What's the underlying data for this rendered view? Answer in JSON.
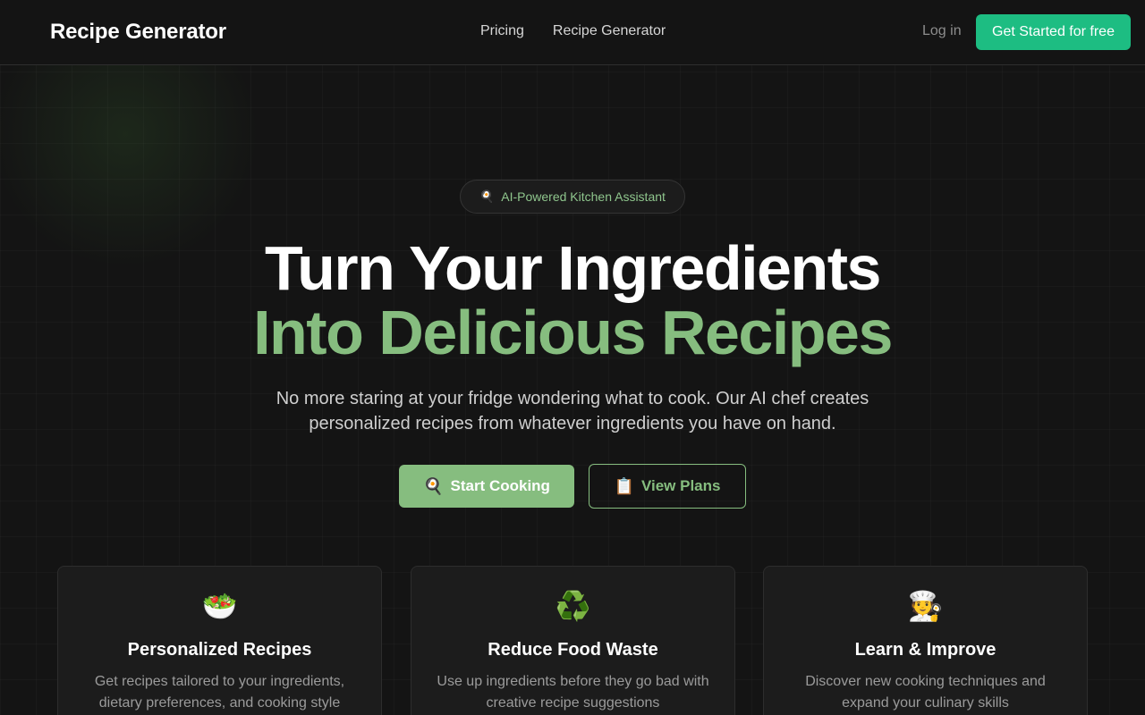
{
  "header": {
    "brand": "Recipe Generator",
    "nav": [
      "Pricing",
      "Recipe Generator"
    ],
    "login": "Log in",
    "cta": "Get Started for free"
  },
  "hero": {
    "badge_icon": "🍳",
    "badge_text": "AI-Powered Kitchen Assistant",
    "title_line1": "Turn Your Ingredients",
    "title_line2": "Into Delicious Recipes",
    "subtitle": "No more staring at your fridge wondering what to cook. Our AI chef creates personalized recipes from whatever ingredients you have on hand.",
    "primary_icon": "🍳",
    "primary_label": "Start Cooking",
    "secondary_icon": "📋",
    "secondary_label": "View Plans"
  },
  "features": [
    {
      "icon": "🥗",
      "title": "Personalized Recipes",
      "desc": "Get recipes tailored to your ingredients, dietary preferences, and cooking style"
    },
    {
      "icon": "♻️",
      "title": "Reduce Food Waste",
      "desc": "Use up ingredients before they go bad with creative recipe suggestions"
    },
    {
      "icon": "🧑‍🍳",
      "title": "Learn & Improve",
      "desc": "Discover new cooking techniques and expand your culinary skills"
    }
  ],
  "colors": {
    "background": "#141414",
    "accent_green": "#86bd7f",
    "cta_green": "#1dbd82",
    "card_bg": "#1c1c1c"
  }
}
